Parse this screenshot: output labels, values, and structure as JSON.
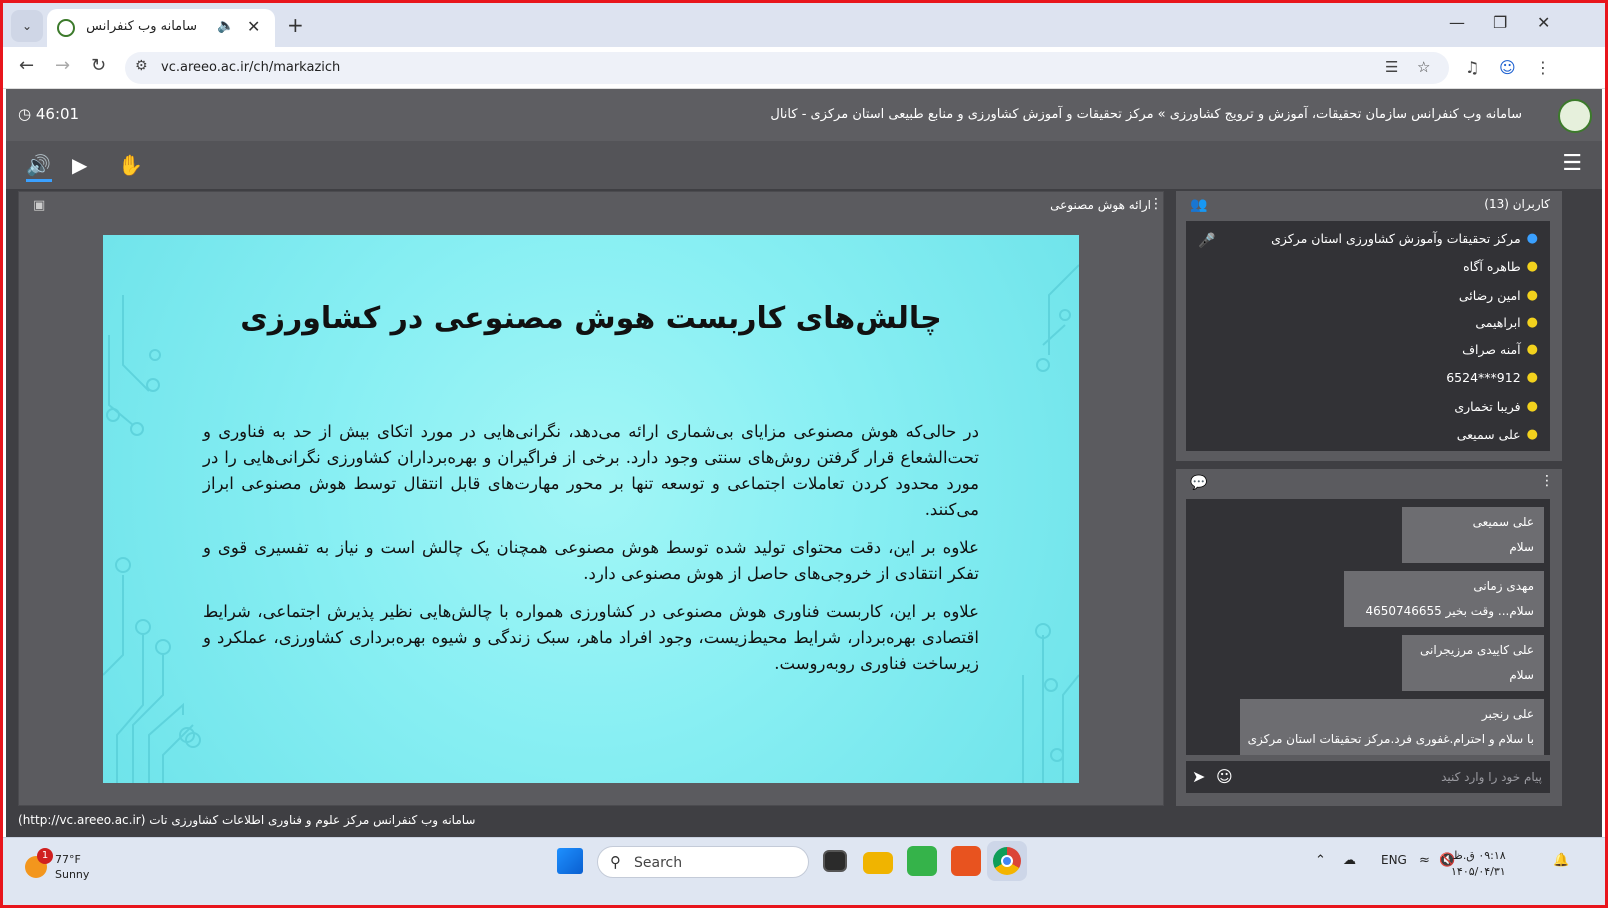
{
  "browser": {
    "tab_title": "سامانه وب کنفرانس سازمان تحقیقات",
    "url": "vc.areeo.ac.ir/ch/markazich"
  },
  "app": {
    "header_title": "سامانه وب کنفرانس سازمان تحقیقات، آموزش و ترویج کشاورزی » مرکز تحقیقات و آموزش کشاورزی و منابع طبیعی استان مرکزی - کانال",
    "timer": "46:01"
  },
  "presentation": {
    "panel_title": "ارائه هوش مصنوعی",
    "slide_title": "چالش‌های کاربست هوش مصنوعی در کشاورزی",
    "paragraphs": [
      "در حالی‌که هوش مصنوعی مزایای بی‌شماری ارائه می‌دهد، نگرانی‌هایی در مورد اتکای بیش از حد به فناوری و تحت‌الشعاع قرار گرفتن روش‌های سنتی وجود دارد. برخی از فراگیران و بهره‌برداران کشاورزی نگرانی‌هایی را در مورد محدود کردن تعاملات اجتماعی و توسعه تنها بر محور مهارت‌های قابل انتقال توسط هوش مصنوعی ابراز می‌کنند.",
      "علاوه بر این، دقت محتوای تولید شده توسط هوش مصنوعی همچنان یک چالش است و نیاز به تفسیری قوی و تفکر انتقادی از خروجی‌های حاصل از هوش مصنوعی دارد.",
      "علاوه بر این، کاربست فناوری هوش مصنوعی در کشاورزی همواره با چالش‌هایی نظیر پذیرش اجتماعی، شرایط اقتصادی بهره‌بردار، شرایط محیط‌زیست، وجود افراد ماهر، سبک زندگی و شیوه بهره‌برداری کشاورزی، عملکرد و زیرساخت فناوری روبه‌روست."
    ]
  },
  "users": {
    "title": "کاربران (13)",
    "list": [
      {
        "name": "مرکز تحقیقات وآموزش کشاورزی استان مرکزی",
        "color": "#3aa0ff"
      },
      {
        "name": "طاهره آگاه",
        "color": "#f3d21d"
      },
      {
        "name": "امین رضائی",
        "color": "#f3d21d"
      },
      {
        "name": "ابراهیمی",
        "color": "#f3d21d"
      },
      {
        "name": "آمنه صراف",
        "color": "#f3d21d"
      },
      {
        "name": "912***6524",
        "color": "#f3d21d"
      },
      {
        "name": "فریبا تخماری",
        "color": "#f3d21d"
      },
      {
        "name": "علی سمیعی",
        "color": "#f3d21d"
      }
    ]
  },
  "chat": {
    "messages": [
      {
        "name": "علی سمیعی",
        "text": "سلام"
      },
      {
        "name": "مهدی زمانی",
        "text": "سلام... وقت بخیر   4650746655"
      },
      {
        "name": "علی کاییدی مرزیجرانی",
        "text": "سلام"
      },
      {
        "name": "علی رنجبر",
        "text": "با سلام و احترام.غفوری فرد.مرکز تحقیقات استان مرکزی"
      }
    ],
    "placeholder": "پیام خود را وارد کنید"
  },
  "footer": "سامانه وب کنفرانس مرکز علوم و فناوری اطلاعات کشاورزی تات (http://vc.areeo.ac.ir)",
  "taskbar": {
    "temp": "77°F",
    "condition": "Sunny",
    "badge": "1",
    "search": "Search",
    "lang": "ENG",
    "time": "۰۹:۱۸ ق.ظ",
    "date": "۱۴۰۵/۰۴/۳۱"
  }
}
